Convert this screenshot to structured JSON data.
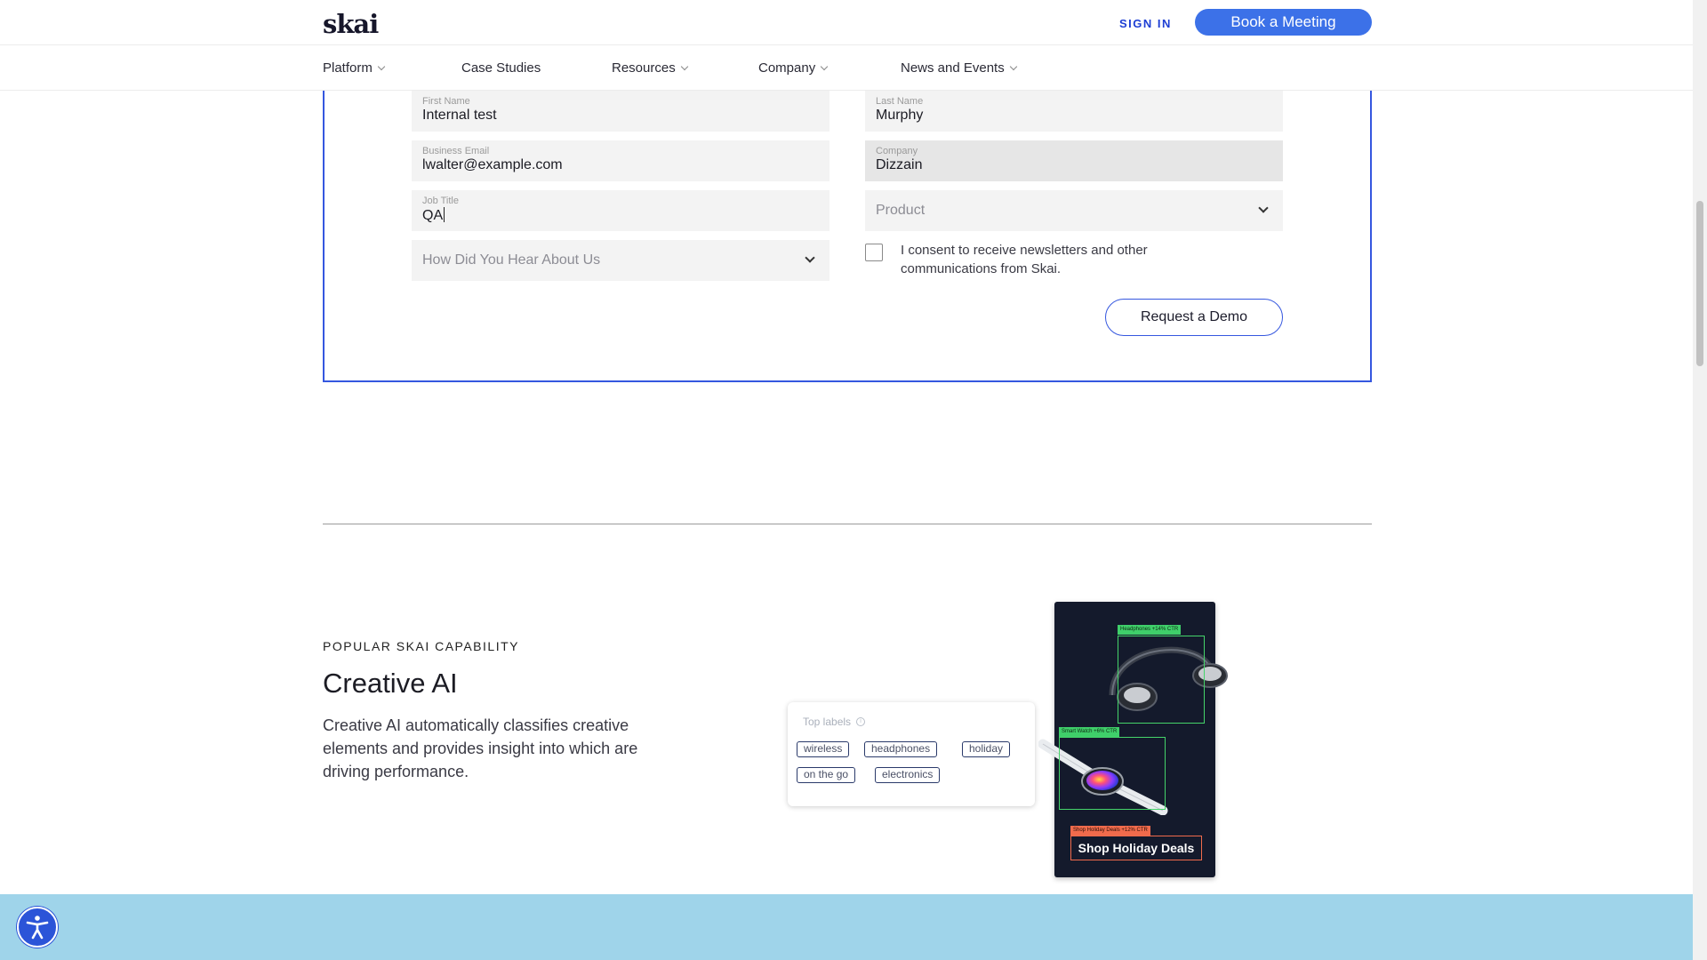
{
  "header": {
    "logo": "skai",
    "sign_in": "SIGN IN",
    "book_meeting": "Book a Meeting"
  },
  "nav": {
    "items": [
      {
        "label": "Platform",
        "has_dropdown": true
      },
      {
        "label": "Case Studies",
        "has_dropdown": false
      },
      {
        "label": "Resources",
        "has_dropdown": true
      },
      {
        "label": "Company",
        "has_dropdown": true
      },
      {
        "label": "News and Events",
        "has_dropdown": true
      }
    ]
  },
  "form": {
    "first_name": {
      "label": "First Name",
      "value": "Internal test"
    },
    "last_name": {
      "label": "Last Name",
      "value": "Murphy"
    },
    "email": {
      "label": "Business Email",
      "value": "lwalter@example.com"
    },
    "company": {
      "label": "Company",
      "value": "Dizzain"
    },
    "job_title": {
      "label": "Job Title",
      "value": "QA"
    },
    "product": {
      "placeholder": "Product"
    },
    "hear_about": {
      "placeholder": "How Did You Hear About Us"
    },
    "consent": {
      "text": "I consent to receive newsletters and other communications from Skai.",
      "checked": false
    },
    "submit": "Request a Demo"
  },
  "capability": {
    "eyebrow": "POPULAR SKAI CAPABILITY",
    "title": "Creative AI",
    "description": "Creative AI automatically classifies creative elements and provides insight into which are driving performance."
  },
  "labels_card": {
    "title": "Top labels",
    "tags": [
      "wireless",
      "headphones",
      "holiday",
      "on the go",
      "electronics"
    ]
  },
  "ad_preview": {
    "headphones_tag": "Headphones +14% CTR",
    "watch_tag": "Smart Watch +6% CTR",
    "cta_tag": "Shop Holiday Deals +12% CTR",
    "cta": "Shop Holiday Deals"
  },
  "colors": {
    "accent": "#3c71e8",
    "form_border": "#3557df",
    "band": "#9fd4ea",
    "detection_green": "#3fcf6a",
    "detection_red": "#f06b4c"
  },
  "icons": [
    "chevron-down-icon",
    "info-icon",
    "accessibility-icon"
  ]
}
